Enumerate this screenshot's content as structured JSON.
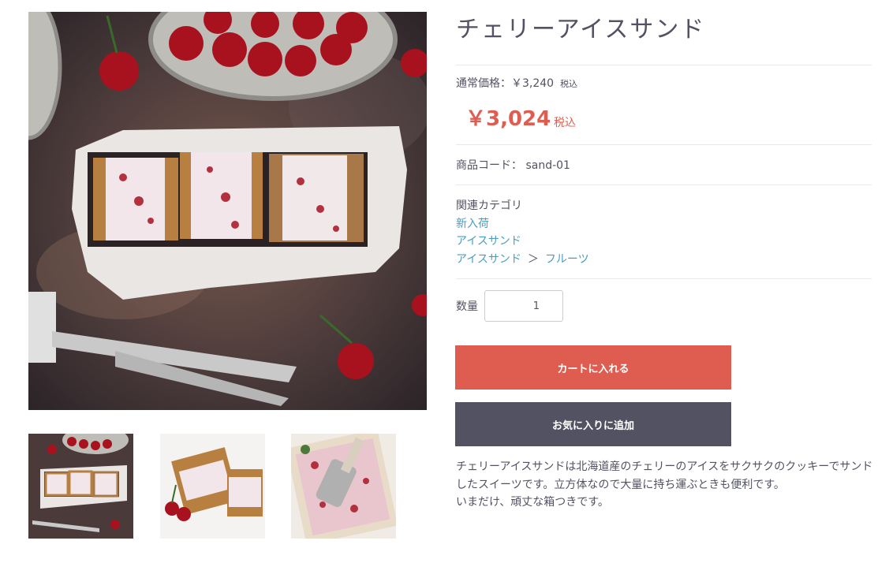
{
  "product": {
    "title": "チェリーアイスサンド",
    "normal_price_label": "通常価格：￥3,240",
    "normal_price_tax": "税込",
    "sale_price": "￥3,024",
    "sale_price_tax": "税込",
    "code_label": "商品コード：",
    "code_value": "sand-01",
    "category_heading": "関連カテゴリ",
    "categories": {
      "c1": "新入荷",
      "c2": "アイスサンド",
      "c3_parent": "アイスサンド",
      "c3_sep": "＞",
      "c3_child": "フルーツ"
    },
    "quantity_label": "数量",
    "quantity_value": "1",
    "cart_button": "カートに入れる",
    "favorite_button": "お気に入りに追加",
    "description": "チェリーアイスサンドは北海道産のチェリーのアイスをサクサクのクッキーでサンドしたスイーツです。立方体なので大量に持ち運ぶときも便利です。\nいまだけ、頑丈な箱つきです。"
  },
  "colors": {
    "accent": "#de5d50",
    "dark_button": "#525263",
    "link": "#4a9dbf"
  }
}
